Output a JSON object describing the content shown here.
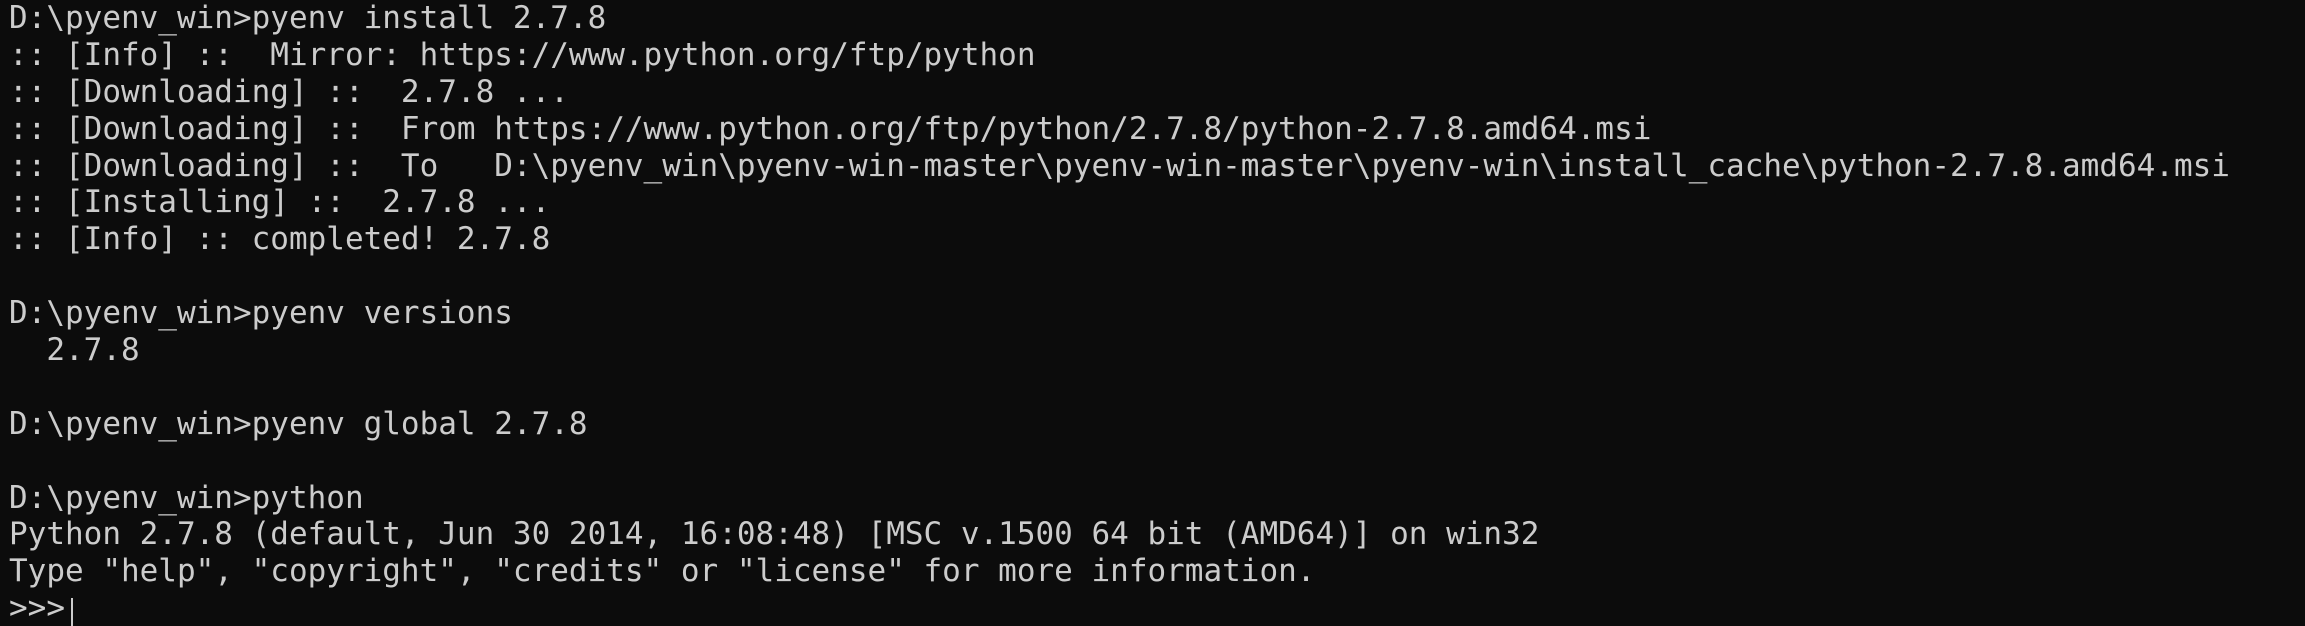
{
  "terminal": {
    "lines": [
      "D:\\pyenv_win>pyenv install 2.7.8",
      ":: [Info] ::  Mirror: https://www.python.org/ftp/python",
      ":: [Downloading] ::  2.7.8 ...",
      ":: [Downloading] ::  From https://www.python.org/ftp/python/2.7.8/python-2.7.8.amd64.msi",
      ":: [Downloading] ::  To   D:\\pyenv_win\\pyenv-win-master\\pyenv-win-master\\pyenv-win\\install_cache\\python-2.7.8.amd64.msi",
      ":: [Installing] ::  2.7.8 ...",
      ":: [Info] :: completed! 2.7.8",
      "",
      "D:\\pyenv_win>pyenv versions",
      "  2.7.8",
      "",
      "D:\\pyenv_win>pyenv global 2.7.8",
      "",
      "D:\\pyenv_win>python",
      "Python 2.7.8 (default, Jun 30 2014, 16:08:48) [MSC v.1500 64 bit (AMD64)] on win32",
      "Type \"help\", \"copyright\", \"credits\" or \"license\" for more information."
    ],
    "prompt": ">>>",
    "colors": {
      "background": "#0c0c0c",
      "foreground": "#cccccc"
    }
  }
}
